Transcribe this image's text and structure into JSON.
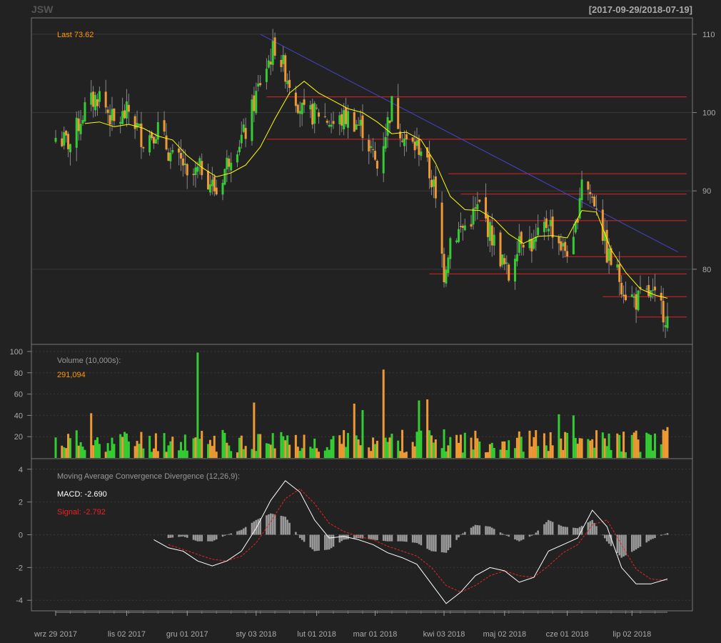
{
  "chart_data": {
    "type": "candlestick",
    "symbol": "JSW",
    "date_range": "[2017-09-29/2018-07-19]",
    "colors": {
      "background": "#222222",
      "panel_border": "#888888",
      "grid": "#3a3a3a",
      "up": "#33cc33",
      "down": "#ee9933",
      "sma": "#ffff00",
      "trendline": "#4444cc",
      "support_lines": "#dd2222",
      "volume_up": "#33cc33",
      "volume_down": "#ee9933",
      "macd": "#ffffff",
      "signal": "#ee2222",
      "histogram": "#999999",
      "label_orange": "#ff9900",
      "label_grey": "#999999",
      "label_white": "#ffffff",
      "label_red": "#ee2222"
    },
    "price_panel": {
      "last_label": "Last 73.62",
      "y_ticks": [
        80,
        90,
        100,
        110
      ],
      "ylim": [
        70.5,
        112
      ],
      "horizontal_levels": [
        {
          "price": 102.0,
          "from": "2018-01-08",
          "to": "2018-07-31"
        },
        {
          "price": 96.6,
          "from": "2018-01-08",
          "to": "2018-07-31"
        },
        {
          "price": 92.2,
          "from": "2018-04-05",
          "to": "2018-07-31"
        },
        {
          "price": 89.6,
          "from": "2018-04-11",
          "to": "2018-07-31"
        },
        {
          "price": 86.2,
          "from": "2018-04-20",
          "to": "2018-07-31"
        },
        {
          "price": 81.6,
          "from": "2018-05-30",
          "to": "2018-07-31"
        },
        {
          "price": 79.4,
          "from": "2018-03-27",
          "to": "2018-07-31"
        },
        {
          "price": 76.5,
          "from": "2018-06-18",
          "to": "2018-07-31"
        },
        {
          "price": 73.9,
          "from": "2018-07-04",
          "to": "2018-07-31"
        }
      ],
      "trendline": {
        "from": {
          "date": "2018-01-05",
          "price": 110.0
        },
        "to": {
          "date": "2018-07-24",
          "price": 82.2
        }
      },
      "sma_anchors": [
        [
          "2017-10-13",
          98.6
        ],
        [
          "2017-10-20",
          98.8
        ],
        [
          "2017-10-27",
          98.2
        ],
        [
          "2017-11-03",
          98.5
        ],
        [
          "2017-11-10",
          98.0
        ],
        [
          "2017-11-17",
          97.0
        ],
        [
          "2017-11-24",
          96.5
        ],
        [
          "2017-12-01",
          94.5
        ],
        [
          "2017-12-08",
          93.0
        ],
        [
          "2017-12-15",
          91.8
        ],
        [
          "2017-12-22",
          92.3
        ],
        [
          "2017-12-29",
          93.3
        ],
        [
          "2018-01-05",
          95.6
        ],
        [
          "2018-01-12",
          99.2
        ],
        [
          "2018-01-19",
          102.5
        ],
        [
          "2018-01-26",
          104.0
        ],
        [
          "2018-02-02",
          102.5
        ],
        [
          "2018-02-09",
          101.5
        ],
        [
          "2018-02-16",
          100.5
        ],
        [
          "2018-02-23",
          100.0
        ],
        [
          "2018-03-02",
          98.8
        ],
        [
          "2018-03-09",
          97.3
        ],
        [
          "2018-03-16",
          97.5
        ],
        [
          "2018-03-23",
          96.5
        ],
        [
          "2018-03-30",
          93.5
        ],
        [
          "2018-04-06",
          89.3
        ],
        [
          "2018-04-13",
          87.6
        ],
        [
          "2018-04-20",
          87.5
        ],
        [
          "2018-04-27",
          86.4
        ],
        [
          "2018-05-04",
          84.5
        ],
        [
          "2018-05-11",
          83.3
        ],
        [
          "2018-05-18",
          84.2
        ],
        [
          "2018-05-25",
          84.3
        ],
        [
          "2018-06-01",
          84.0
        ],
        [
          "2018-06-08",
          87.5
        ],
        [
          "2018-06-15",
          87.3
        ],
        [
          "2018-06-22",
          82.5
        ],
        [
          "2018-06-29",
          79.6
        ],
        [
          "2018-07-06",
          77.5
        ],
        [
          "2018-07-13",
          76.7
        ],
        [
          "2018-07-19",
          76.3
        ]
      ],
      "close_anchors": [
        [
          "2017-09-29",
          96.8
        ],
        [
          "2017-10-06",
          96.0
        ],
        [
          "2017-10-13",
          100.5
        ],
        [
          "2017-10-20",
          102.3
        ],
        [
          "2017-10-27",
          98.5
        ],
        [
          "2017-11-03",
          100.2
        ],
        [
          "2017-11-10",
          96.5
        ],
        [
          "2017-11-17",
          98.0
        ],
        [
          "2017-11-24",
          94.0
        ],
        [
          "2017-11-29",
          93.5
        ],
        [
          "2017-12-01",
          91.0
        ],
        [
          "2017-12-08",
          93.0
        ],
        [
          "2017-12-15",
          89.8
        ],
        [
          "2017-12-22",
          95.0
        ],
        [
          "2017-12-29",
          97.5
        ],
        [
          "2018-01-05",
          104.0
        ],
        [
          "2018-01-12",
          108.5
        ],
        [
          "2018-01-19",
          104.0
        ],
        [
          "2018-01-26",
          99.5
        ],
        [
          "2018-02-02",
          100.0
        ],
        [
          "2018-02-09",
          98.5
        ],
        [
          "2018-02-16",
          99.5
        ],
        [
          "2018-02-23",
          98.0
        ],
        [
          "2018-03-02",
          93.0
        ],
        [
          "2018-03-05",
          96.5
        ],
        [
          "2018-03-09",
          101.0
        ],
        [
          "2018-03-16",
          96.0
        ],
        [
          "2018-03-23",
          95.5
        ],
        [
          "2018-03-29",
          90.5
        ],
        [
          "2018-04-03",
          79.5
        ],
        [
          "2018-04-06",
          84.0
        ],
        [
          "2018-04-13",
          85.5
        ],
        [
          "2018-04-20",
          88.0
        ],
        [
          "2018-04-27",
          83.5
        ],
        [
          "2018-05-04",
          79.0
        ],
        [
          "2018-05-09",
          84.5
        ],
        [
          "2018-05-16",
          83.0
        ],
        [
          "2018-05-23",
          86.2
        ],
        [
          "2018-05-30",
          82.5
        ],
        [
          "2018-06-04",
          82.8
        ],
        [
          "2018-06-08",
          92.0
        ],
        [
          "2018-06-13",
          89.0
        ],
        [
          "2018-06-15",
          88.5
        ],
        [
          "2018-06-20",
          82.0
        ],
        [
          "2018-06-25",
          79.5
        ],
        [
          "2018-06-29",
          77.0
        ],
        [
          "2018-07-04",
          76.0
        ],
        [
          "2018-07-10",
          76.8
        ],
        [
          "2018-07-16",
          75.2
        ],
        [
          "2018-07-19",
          73.6
        ]
      ]
    },
    "volume_panel": {
      "label": "Volume (10,000s):",
      "last_value": "291,094",
      "y_ticks": [
        20,
        40,
        60,
        80,
        100
      ],
      "ylim": [
        0,
        100
      ],
      "spikes": [
        [
          "2017-12-06",
          99
        ],
        [
          "2018-03-05",
          83
        ],
        [
          "2018-01-02",
          52
        ],
        [
          "2018-02-19",
          51
        ],
        [
          "2018-02-23",
          45
        ],
        [
          "2018-03-26",
          55
        ],
        [
          "2018-03-22",
          54
        ],
        [
          "2017-10-16",
          42
        ],
        [
          "2018-05-28",
          41
        ],
        [
          "2018-06-04",
          40
        ],
        [
          "2018-07-19",
          29
        ]
      ]
    },
    "macd_panel": {
      "label": "Moving Average Convergence Divergence (12,26,9):",
      "macd_label": "MACD: -2.690",
      "signal_label": "Signal: -2.792",
      "y_ticks": [
        -4,
        -2,
        0,
        2,
        4
      ],
      "ylim": [
        -4.6,
        4.6
      ],
      "macd_anchors": [
        [
          "2017-11-15",
          -0.3
        ],
        [
          "2017-11-22",
          -0.8
        ],
        [
          "2017-11-29",
          -1.0
        ],
        [
          "2017-12-06",
          -1.6
        ],
        [
          "2017-12-13",
          -1.9
        ],
        [
          "2017-12-20",
          -1.6
        ],
        [
          "2017-12-27",
          -1.0
        ],
        [
          "2018-01-03",
          0.4
        ],
        [
          "2018-01-10",
          2.1
        ],
        [
          "2018-01-17",
          3.3
        ],
        [
          "2018-01-24",
          2.6
        ],
        [
          "2018-01-31",
          0.9
        ],
        [
          "2018-02-07",
          -0.2
        ],
        [
          "2018-02-14",
          -0.1
        ],
        [
          "2018-02-21",
          -0.3
        ],
        [
          "2018-02-28",
          -0.6
        ],
        [
          "2018-03-07",
          -1.1
        ],
        [
          "2018-03-14",
          -1.4
        ],
        [
          "2018-03-21",
          -1.8
        ],
        [
          "2018-03-28",
          -3.0
        ],
        [
          "2018-04-04",
          -4.2
        ],
        [
          "2018-04-11",
          -3.5
        ],
        [
          "2018-04-18",
          -2.5
        ],
        [
          "2018-04-25",
          -2.0
        ],
        [
          "2018-05-02",
          -2.2
        ],
        [
          "2018-05-09",
          -2.9
        ],
        [
          "2018-05-16",
          -2.6
        ],
        [
          "2018-05-23",
          -1.0
        ],
        [
          "2018-05-30",
          -0.6
        ],
        [
          "2018-06-06",
          -0.2
        ],
        [
          "2018-06-13",
          1.5
        ],
        [
          "2018-06-20",
          0.5
        ],
        [
          "2018-06-27",
          -2.0
        ],
        [
          "2018-07-04",
          -3.0
        ],
        [
          "2018-07-11",
          -3.0
        ],
        [
          "2018-07-19",
          -2.7
        ]
      ],
      "signal_anchors": [
        [
          "2017-11-22",
          -0.6
        ],
        [
          "2017-11-29",
          -0.9
        ],
        [
          "2017-12-06",
          -1.2
        ],
        [
          "2017-12-13",
          -1.5
        ],
        [
          "2017-12-20",
          -1.6
        ],
        [
          "2017-12-27",
          -1.3
        ],
        [
          "2018-01-03",
          -0.5
        ],
        [
          "2018-01-10",
          0.8
        ],
        [
          "2018-01-17",
          2.2
        ],
        [
          "2018-01-24",
          2.8
        ],
        [
          "2018-01-31",
          1.9
        ],
        [
          "2018-02-07",
          0.7
        ],
        [
          "2018-02-14",
          0.2
        ],
        [
          "2018-02-21",
          -0.1
        ],
        [
          "2018-02-28",
          -0.3
        ],
        [
          "2018-03-07",
          -0.7
        ],
        [
          "2018-03-14",
          -1.0
        ],
        [
          "2018-03-21",
          -1.3
        ],
        [
          "2018-03-28",
          -2.0
        ],
        [
          "2018-04-04",
          -3.1
        ],
        [
          "2018-04-11",
          -3.5
        ],
        [
          "2018-04-18",
          -3.1
        ],
        [
          "2018-04-25",
          -2.5
        ],
        [
          "2018-05-02",
          -2.2
        ],
        [
          "2018-05-09",
          -2.5
        ],
        [
          "2018-05-16",
          -2.6
        ],
        [
          "2018-05-23",
          -1.9
        ],
        [
          "2018-05-30",
          -1.1
        ],
        [
          "2018-06-06",
          -0.6
        ],
        [
          "2018-06-13",
          0.6
        ],
        [
          "2018-06-20",
          0.9
        ],
        [
          "2018-06-27",
          -0.6
        ],
        [
          "2018-07-04",
          -2.1
        ],
        [
          "2018-07-11",
          -2.7
        ],
        [
          "2018-07-19",
          -2.8
        ]
      ]
    },
    "x_axis": {
      "start": "2017-09-29",
      "end": "2018-07-19",
      "tick_labels": [
        {
          "date": "2017-09-29",
          "label": "wrz 29 2017"
        },
        {
          "date": "2017-11-02",
          "label": "lis 02 2017"
        },
        {
          "date": "2017-12-01",
          "label": "gru 01 2017"
        },
        {
          "date": "2018-01-03",
          "label": "sty 03 2018"
        },
        {
          "date": "2018-02-01",
          "label": "lut 01 2018"
        },
        {
          "date": "2018-03-01",
          "label": "mar 01 2018"
        },
        {
          "date": "2018-04-03",
          "label": "kwi 03 2018"
        },
        {
          "date": "2018-05-02",
          "label": "maj 02 2018"
        },
        {
          "date": "2018-06-01",
          "label": "cze 01 2018"
        },
        {
          "date": "2018-07-02",
          "label": "lip 02 2018"
        }
      ]
    }
  }
}
